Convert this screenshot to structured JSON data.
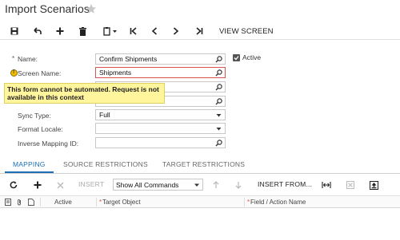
{
  "page": {
    "title": "Import Scenarios"
  },
  "toolbar": {
    "view_screen_label": "VIEW SCREEN"
  },
  "form": {
    "name_label": "Name:",
    "name_value": "Confirm Shipments",
    "screen_name_label": "Screen Name:",
    "screen_name_value": "Shipments",
    "sync_type_label": "Sync Type:",
    "sync_type_value": "Full",
    "format_locale_label": "Format Locale:",
    "format_locale_value": "",
    "inverse_mapping_label": "Inverse Mapping ID:",
    "inverse_mapping_value": "",
    "active_label": "Active",
    "active_checked": true
  },
  "tooltip": {
    "text": "This form cannot be automated. Request is not available in this context"
  },
  "tabs": {
    "mapping": "MAPPING",
    "source_restrictions": "SOURCE RESTRICTIONS",
    "target_restrictions": "TARGET RESTRICTIONS"
  },
  "grid_toolbar": {
    "insert_label": "INSERT",
    "commands_value": "Show All Commands",
    "insert_from_label": "INSERT FROM..."
  },
  "grid": {
    "columns": [
      "Active",
      "Target Object",
      "Field / Action Name"
    ]
  },
  "colors": {
    "accent": "#1a6fb5",
    "tooltip_bg": "#fff59d",
    "error_border": "#d9534f"
  }
}
